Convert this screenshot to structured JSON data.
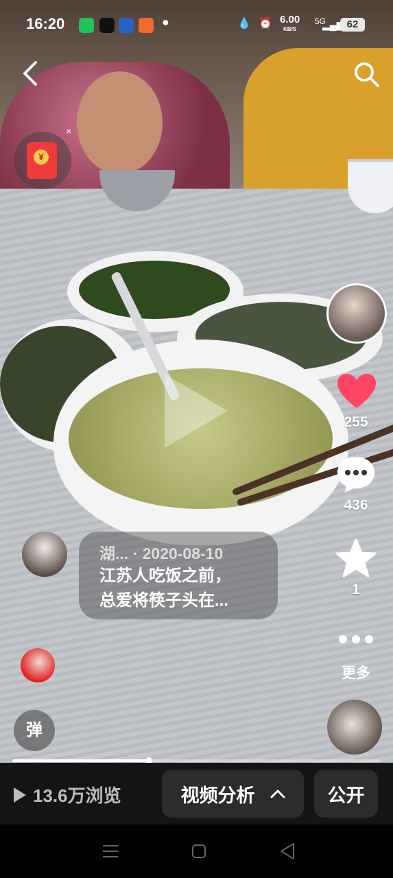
{
  "status_bar": {
    "time": "16:20",
    "network_speed": "6.00",
    "network_speed_unit": "KB/S",
    "signal": "5G",
    "battery": "62"
  },
  "video": {
    "author_handle": "湖...",
    "date": "· 2020-08-10",
    "caption_line1": "江苏人吃饭之前，",
    "caption_line2": "总爱将筷子头在...",
    "progress": 0.37
  },
  "actions": {
    "likes": "255",
    "comments": "436",
    "favorites": "1",
    "more_label": "更多"
  },
  "danmu_label": "弹",
  "redpacket_close": "×",
  "redpacket_coin": "¥",
  "bottom_bar": {
    "views": "13.6万浏览",
    "analysis_label": "视频分析",
    "public_label": "公开"
  },
  "colors": {
    "like": "#ff4466",
    "bottom_bar_bg": "#141414",
    "button_bg": "#2c2c2c"
  }
}
